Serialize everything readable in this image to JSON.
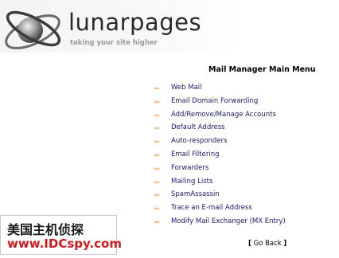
{
  "header": {
    "brand_name": "lunarpages",
    "tagline": "taking your site higher",
    "logo_icon": "lunarpages-swirl-logo"
  },
  "main": {
    "title": "Mail Manager Main Menu",
    "arrow_glyph": "»»",
    "arrow_color": "#e8a05a",
    "items": [
      {
        "label": "Web Mail"
      },
      {
        "label": "Email Domain Forwarding"
      },
      {
        "label": "Add/Remove/Manage Accounts"
      },
      {
        "label": "Default Address"
      },
      {
        "label": "Auto-responders"
      },
      {
        "label": "Email Filtering"
      },
      {
        "label": "Forwarders"
      },
      {
        "label": "Mailing Lists"
      },
      {
        "label": "SpamAssassin"
      },
      {
        "label": "Trace an E-mail Address"
      },
      {
        "label": "Modify Mail Exchanger (MX Entry)"
      }
    ],
    "go_back": {
      "open_bracket": "[",
      "label": "Go Back",
      "close_bracket": "]"
    }
  },
  "watermark": {
    "line1": "美国主机侦探",
    "line2": "www.IDCspy.com",
    "line2_color": "#c81e1e"
  }
}
